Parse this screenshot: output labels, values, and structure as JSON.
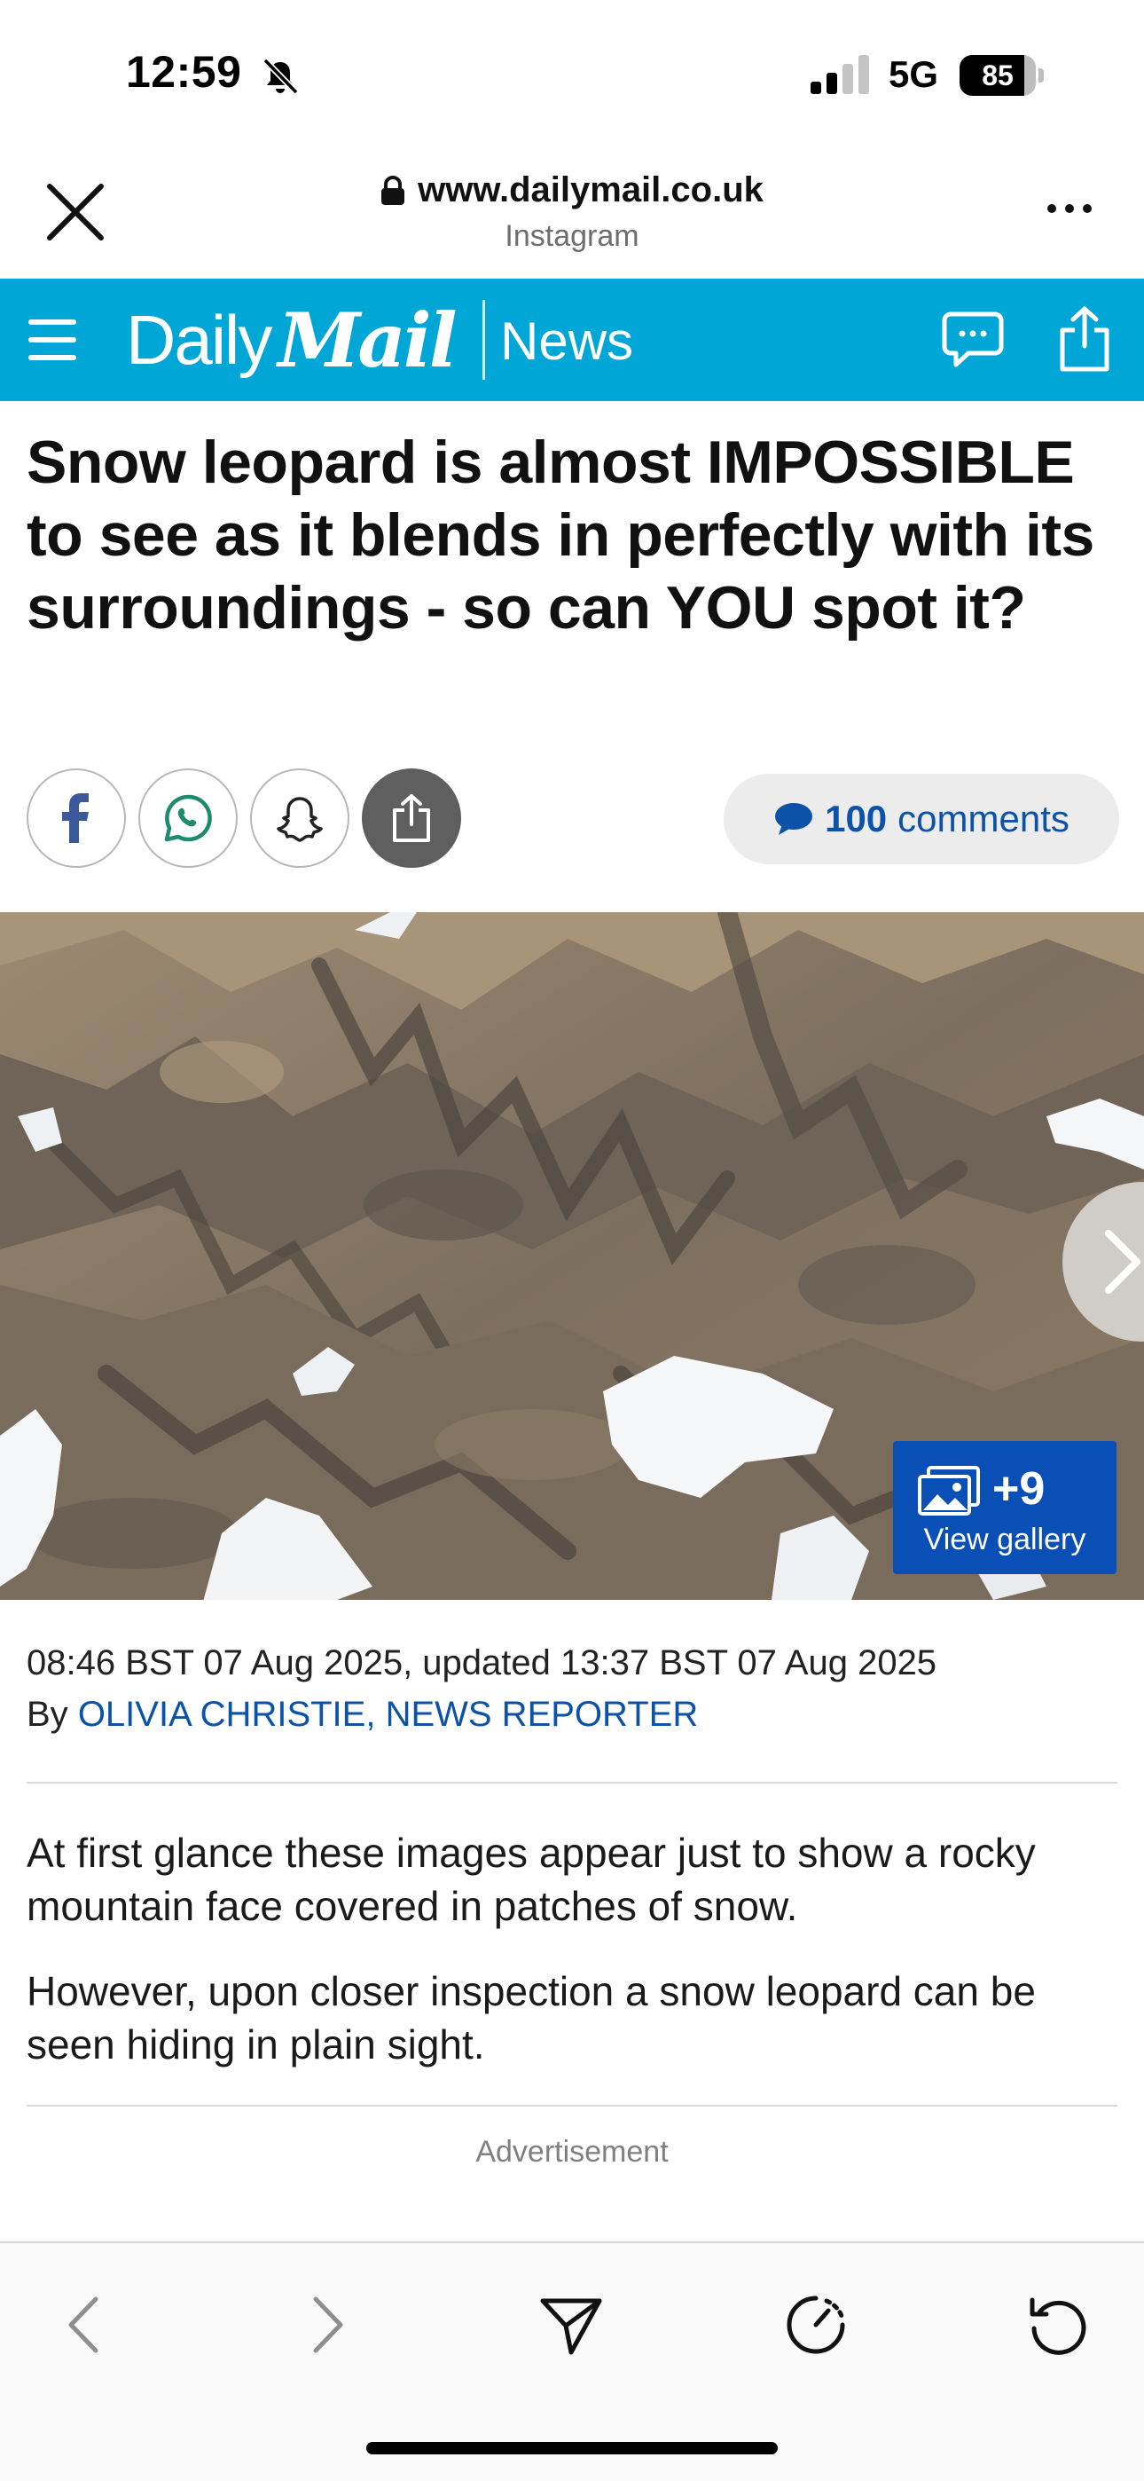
{
  "status_bar": {
    "time": "12:59",
    "network": "5G",
    "battery_percent": "85",
    "battery_level": 0.85
  },
  "browser": {
    "url": "www.dailymail.co.uk",
    "source": "Instagram"
  },
  "header": {
    "logo_daily": "Daily",
    "logo_mail": "Mail",
    "section": "News",
    "brand_color": "#00a6d6"
  },
  "article": {
    "headline": "Snow leopard is almost IMPOSSIBLE to see as it blends in perfectly with its surroundings - so can YOU spot it?",
    "comments_count": "100",
    "comments_label": "comments",
    "gallery_count": "+9",
    "gallery_label": "View gallery",
    "dateline": "08:46 BST 07 Aug 2025, updated 13:37 BST 07 Aug 2025",
    "byline_prefix": "By",
    "author": "OLIVIA CHRISTIE, NEWS REPORTER",
    "paragraphs": [
      "At first glance these images appear just to show a rocky mountain face covered in patches of snow.",
      "However, upon closer inspection a snow leopard can be seen hiding in plain sight."
    ],
    "advertisement_label": "Advertisement"
  },
  "icons": {
    "bell": "bell-slash-icon",
    "close": "close-icon",
    "lock": "lock-icon",
    "more": "more-icon",
    "menu": "hamburger-menu-icon",
    "comments": "comment-bubble-icon",
    "share": "share-icon",
    "facebook": "facebook-icon",
    "whatsapp": "whatsapp-icon",
    "snapchat": "snapchat-icon",
    "gallery": "gallery-icon",
    "back": "chevron-left-icon",
    "forward": "chevron-right-icon",
    "send": "send-icon",
    "timer": "timer-icon",
    "reload": "reload-icon"
  }
}
